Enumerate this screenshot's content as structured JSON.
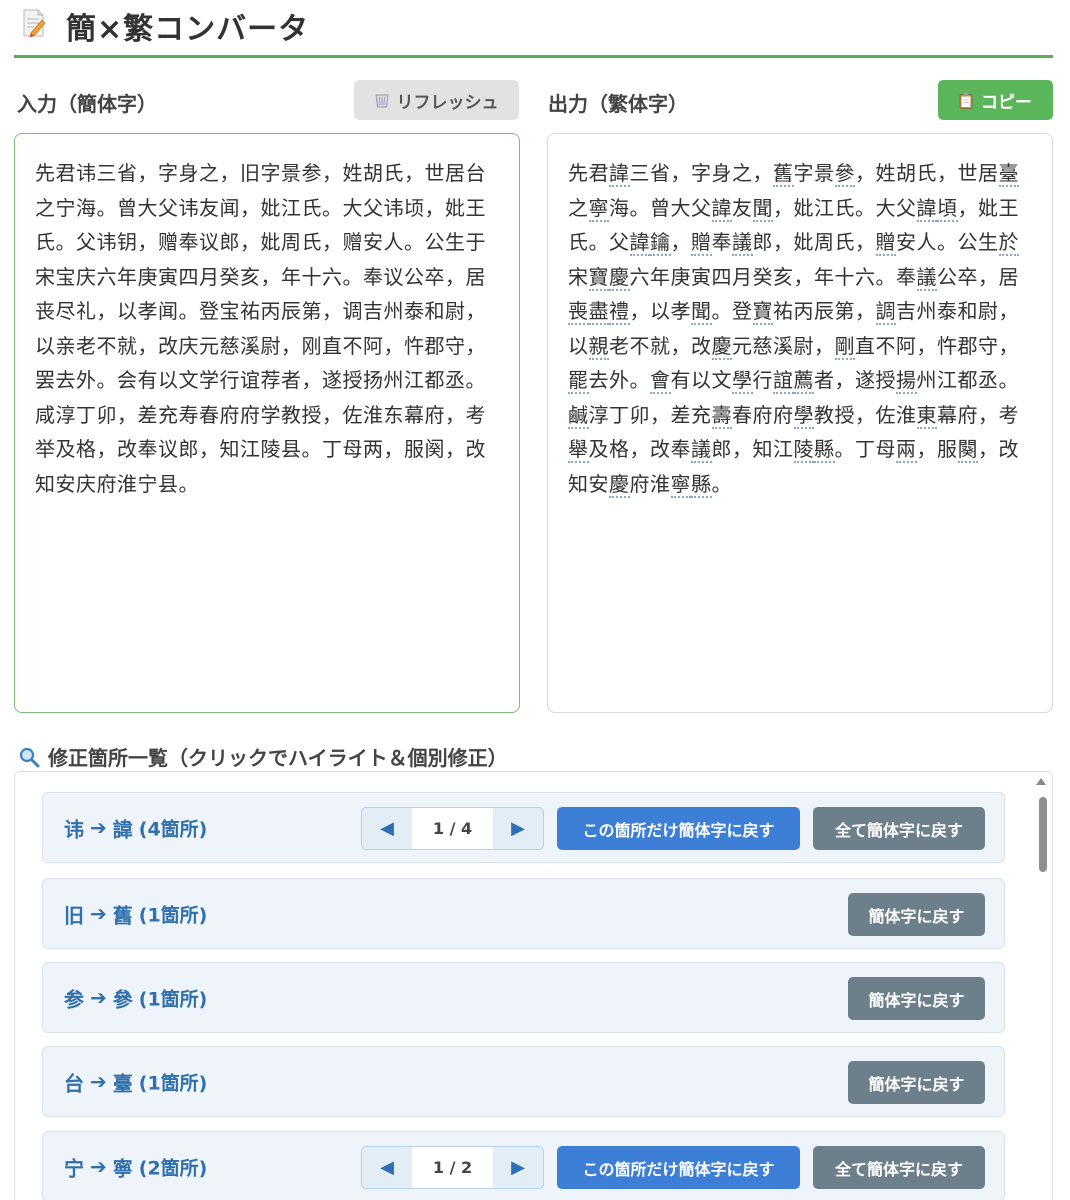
{
  "app": {
    "title": "簡×繁コンバータ",
    "icon": "memo-pencil-icon",
    "accent_color": "#5aae5a"
  },
  "input_pane": {
    "label": "入力（簡体字）",
    "refresh_label": "リフレッシュ",
    "text": "先君讳三省，字身之，旧字景参，姓胡氏，世居台之宁海。曾大父讳友闻，妣江氏。大父讳顷，妣王氏。父讳钥，赠奉议郎，妣周氏，赠安人。公生于宋宝庆六年庚寅四月癸亥，年十六。奉议公卒，居丧尽礼，以孝闻。登宝祐丙辰第，调吉州泰和尉，以亲老不就，改庆元慈溪尉，刚直不阿，忤郡守，罢去外。会有以文学行谊荐者，遂授扬州江都丞。咸淳丁卯，差充寿春府府学教授，佐淮东幕府，考举及格，改奉议郎，知江陵县。丁母两，服阕，改知安庆府淮宁县。"
  },
  "output_pane": {
    "label": "出力（繁体字）",
    "copy_label": "コピー",
    "text": "先君諱三省，字身之，舊字景參，姓胡氏，世居臺之寧海。曾大父諱友聞，妣江氏。大父諱頃，妣王氏。父諱鑰，贈奉議郎，妣周氏，贈安人。公生於宋寶慶六年庚寅四月癸亥，年十六。奉議公卒，居喪盡禮，以孝聞。登寶祐丙辰第，調吉州泰和尉，以親老不就，改慶元慈溪尉，剛直不阿，忤郡守，罷去外。會有以文學行誼薦者，遂授揚州江都丞。鹹淳丁卯，差充壽春府府學教授，佐淮東幕府，考舉及格，改奉議郎，知江陵縣。丁母兩，服闋，改知安慶府淮寧縣。",
    "highlighted_chars": "諱舊參臺寧聞頃鑰贈議於寶慶喪盡禮調親剛罷會學誼薦揚鹹壽東舉陵縣兩闋"
  },
  "corrections": {
    "title": "修正箇所一覧（クリックでハイライト＆個別修正）",
    "icon": "magnifier-icon",
    "items": [
      {
        "from": "讳",
        "to": "諱",
        "count": "(4箇所)",
        "multi": true,
        "pager": "1 / 4",
        "this_label": "この箇所だけ簡体字に戻す",
        "all_label": "全て簡体字に戻す"
      },
      {
        "from": "旧",
        "to": "舊",
        "count": "(1箇所)",
        "multi": false,
        "revert_label": "簡体字に戻す"
      },
      {
        "from": "参",
        "to": "參",
        "count": "(1箇所)",
        "multi": false,
        "revert_label": "簡体字に戻す"
      },
      {
        "from": "台",
        "to": "臺",
        "count": "(1箇所)",
        "multi": false,
        "revert_label": "簡体字に戻す"
      },
      {
        "from": "宁",
        "to": "寧",
        "count": "(2箇所)",
        "multi": true,
        "pager": "1 / 2",
        "this_label": "この箇所だけ簡体字に戻す",
        "all_label": "全て簡体字に戻す"
      }
    ]
  }
}
